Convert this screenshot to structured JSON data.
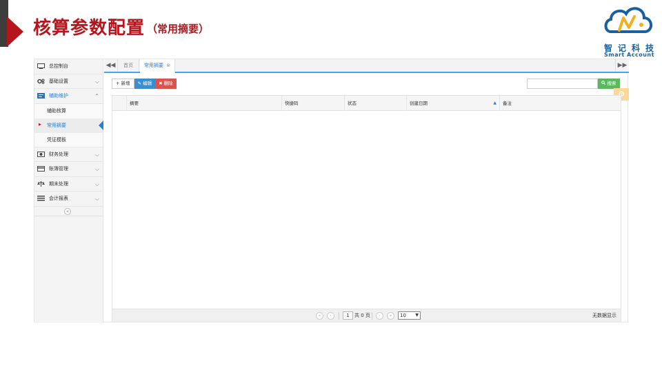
{
  "slide": {
    "title": "核算参数配置",
    "subtitle": "（常用摘要）",
    "logo_cn": "智记科技",
    "logo_en": "Smart Account",
    "accent_color": "#b5151b",
    "marker_dark_color": "#3d3d3d"
  },
  "sidebar": {
    "items": [
      {
        "label": "总控制台",
        "icon": "monitor-icon",
        "has_chevron": false
      },
      {
        "label": "基础设置",
        "icon": "gears-icon",
        "has_chevron": true
      },
      {
        "label": "辅助维护",
        "icon": "card-list-icon",
        "has_chevron": true,
        "expanded": true
      },
      {
        "label": "财务处理",
        "icon": "money-icon",
        "has_chevron": true
      },
      {
        "label": "账簿管理",
        "icon": "credit-card-icon",
        "has_chevron": true
      },
      {
        "label": "期末处理",
        "icon": "balance-scale-icon",
        "has_chevron": true
      },
      {
        "label": "会计报表",
        "icon": "list-icon",
        "has_chevron": true
      }
    ],
    "sub_items": [
      {
        "label": "辅助核算",
        "active": false
      },
      {
        "label": "常用摘要",
        "active": true
      },
      {
        "label": "凭证模板",
        "active": false
      }
    ],
    "collapse_symbol": "«"
  },
  "tabs": {
    "prev_symbol": "◀◀",
    "home_label": "首页",
    "active_label": "常用摘要",
    "close_symbol": "⊗",
    "next_symbol": "▶▶"
  },
  "toolbar": {
    "add_label": "新增",
    "edit_label": "编辑",
    "delete_label": "删除",
    "add_icon": "+",
    "edit_icon": "✎",
    "delete_icon": "✖"
  },
  "search": {
    "value": "",
    "button_label": "搜索",
    "button_icon": "🔍"
  },
  "table": {
    "columns": [
      "摘要",
      "快捷码",
      "状态",
      "创建日期",
      "备注"
    ],
    "sort_column": "创建日期",
    "rows": []
  },
  "pagination": {
    "page": "1",
    "total_text": "共 0 页",
    "page_size": "10",
    "empty_text": "无数据显示"
  }
}
